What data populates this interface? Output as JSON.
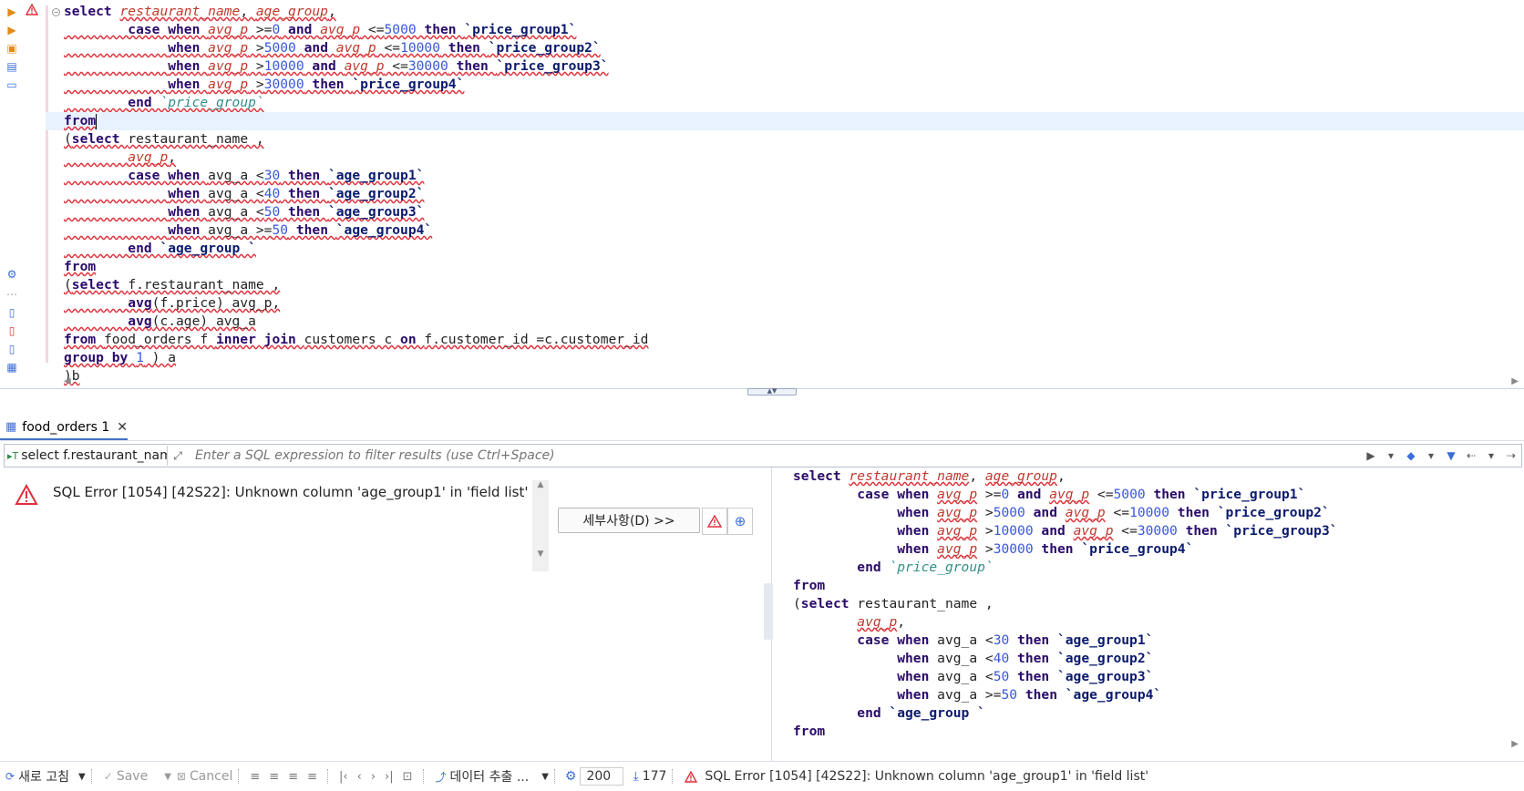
{
  "editor": {
    "lines": [
      [
        [
          "k",
          "select "
        ],
        [
          "id sq",
          "restaurant_name"
        ],
        [
          "pl sq",
          ", "
        ],
        [
          "id sq",
          "age_group"
        ],
        [
          "pl sq",
          ","
        ]
      ],
      [
        [
          "pl sq",
          "        "
        ],
        [
          "k sq",
          "case when "
        ],
        [
          "id sq",
          "avg_p"
        ],
        [
          "pl sq",
          " >="
        ],
        [
          "num sq",
          "0"
        ],
        [
          "k sq",
          " and "
        ],
        [
          "id sq",
          "avg_p"
        ],
        [
          "pl sq",
          " <="
        ],
        [
          "num sq",
          "5000"
        ],
        [
          "k sq",
          " then "
        ],
        [
          "bq sq",
          "`price_group1`"
        ]
      ],
      [
        [
          "pl sq",
          "             "
        ],
        [
          "k sq",
          "when "
        ],
        [
          "id sq",
          "avg_p"
        ],
        [
          "pl sq",
          " >"
        ],
        [
          "num sq",
          "5000"
        ],
        [
          "k sq",
          " and "
        ],
        [
          "id sq",
          "avg_p"
        ],
        [
          "pl sq",
          " <="
        ],
        [
          "num sq",
          "10000"
        ],
        [
          "k sq",
          " then "
        ],
        [
          "bq sq",
          "`price_group2`"
        ]
      ],
      [
        [
          "pl sq",
          "             "
        ],
        [
          "k sq",
          "when "
        ],
        [
          "id sq",
          "avg_p"
        ],
        [
          "pl sq",
          " >"
        ],
        [
          "num sq",
          "10000"
        ],
        [
          "k sq",
          " and "
        ],
        [
          "id sq",
          "avg_p"
        ],
        [
          "pl sq",
          " <="
        ],
        [
          "num sq",
          "30000"
        ],
        [
          "k sq",
          " then "
        ],
        [
          "bq sq",
          "`price_group3`"
        ]
      ],
      [
        [
          "pl sq",
          "             "
        ],
        [
          "k sq",
          "when "
        ],
        [
          "id sq",
          "avg_p"
        ],
        [
          "pl sq",
          " >"
        ],
        [
          "num sq",
          "30000"
        ],
        [
          "k sq",
          " then "
        ],
        [
          "bq sq",
          "`price_group4`"
        ]
      ],
      [
        [
          "pl sq",
          "        "
        ],
        [
          "k sq",
          "end "
        ],
        [
          "bqi sq",
          "`price_group`"
        ]
      ],
      [
        [
          "k sq",
          "from"
        ]
      ],
      [
        [
          "pl sq",
          "("
        ],
        [
          "k sq",
          "select "
        ],
        [
          "pl sq",
          "restaurant_name ,"
        ]
      ],
      [
        [
          "pl sq",
          "        "
        ],
        [
          "id sq",
          "avg_p"
        ],
        [
          "pl sq",
          ","
        ]
      ],
      [
        [
          "pl sq",
          "        "
        ],
        [
          "k sq",
          "case when "
        ],
        [
          "pl sq",
          "avg_a <"
        ],
        [
          "num sq",
          "30"
        ],
        [
          "k sq",
          " then "
        ],
        [
          "bq sq",
          "`age_group1`"
        ]
      ],
      [
        [
          "pl sq",
          "             "
        ],
        [
          "k sq",
          "when "
        ],
        [
          "pl sq",
          "avg_a <"
        ],
        [
          "num sq",
          "40"
        ],
        [
          "k sq",
          " then "
        ],
        [
          "bq sq",
          "`age_group2`"
        ]
      ],
      [
        [
          "pl sq",
          "             "
        ],
        [
          "k sq",
          "when "
        ],
        [
          "pl sq",
          "avg_a <"
        ],
        [
          "num sq",
          "50"
        ],
        [
          "k sq",
          " then "
        ],
        [
          "bq sq",
          "`age_group3`"
        ]
      ],
      [
        [
          "pl sq",
          "             "
        ],
        [
          "k sq",
          "when "
        ],
        [
          "pl sq",
          "avg_a >="
        ],
        [
          "num sq",
          "50"
        ],
        [
          "k sq",
          " then "
        ],
        [
          "bq sq",
          "`age_group4`"
        ]
      ],
      [
        [
          "pl sq",
          "        "
        ],
        [
          "k sq",
          "end "
        ],
        [
          "bq sq",
          "`age_group `"
        ]
      ],
      [
        [
          "k sq",
          "from"
        ]
      ],
      [
        [
          "pl sq",
          "("
        ],
        [
          "k sq",
          "select "
        ],
        [
          "pl sq",
          "f.restaurant_name ,"
        ]
      ],
      [
        [
          "pl sq",
          "        "
        ],
        [
          "k sq",
          "avg"
        ],
        [
          "pl sq",
          "(f.price) avg_p,"
        ]
      ],
      [
        [
          "pl sq",
          "        "
        ],
        [
          "k sq",
          "avg"
        ],
        [
          "pl sq",
          "(c.age) avg_a"
        ]
      ],
      [
        [
          "k sq",
          "from "
        ],
        [
          "pl sq",
          "food_orders f "
        ],
        [
          "k sq",
          "inner join "
        ],
        [
          "pl sq",
          "customers c "
        ],
        [
          "k sq",
          "on "
        ],
        [
          "pl sq",
          "f.customer_id =c.customer_id"
        ]
      ],
      [
        [
          "k sq",
          "group by "
        ],
        [
          "num sq",
          "1"
        ],
        [
          "pl sq",
          " ) a"
        ]
      ],
      [
        [
          "pl sq",
          ")b"
        ]
      ]
    ]
  },
  "results_tab": {
    "label": "food_orders 1"
  },
  "filter": {
    "query_label": "select f.restaurant_name",
    "placeholder": "Enter a SQL expression to filter results (use Ctrl+Space)"
  },
  "error": {
    "message": "SQL Error [1054] [42S22]: Unknown column 'age_group1' in 'field list'",
    "details_button": "세부사항(D) >>"
  },
  "sql_preview": {
    "lines": [
      [
        [
          "k",
          "select "
        ],
        [
          "id sq",
          "restaurant_name"
        ],
        [
          "pl",
          ", "
        ],
        [
          "id sq",
          "age_group"
        ],
        [
          "pl",
          ","
        ]
      ],
      [
        [
          "pl",
          "        "
        ],
        [
          "k",
          "case when "
        ],
        [
          "id sq",
          "avg_p"
        ],
        [
          "pl",
          " >="
        ],
        [
          "num",
          "0"
        ],
        [
          "k",
          " and "
        ],
        [
          "id sq",
          "avg_p"
        ],
        [
          "pl",
          " <="
        ],
        [
          "num",
          "5000"
        ],
        [
          "k",
          " then "
        ],
        [
          "bq",
          "`price_group1`"
        ]
      ],
      [
        [
          "pl",
          "             "
        ],
        [
          "k",
          "when "
        ],
        [
          "id sq",
          "avg_p"
        ],
        [
          "pl",
          " >"
        ],
        [
          "num",
          "5000"
        ],
        [
          "k",
          " and "
        ],
        [
          "id sq",
          "avg_p"
        ],
        [
          "pl",
          " <="
        ],
        [
          "num",
          "10000"
        ],
        [
          "k",
          " then "
        ],
        [
          "bq",
          "`price_group2`"
        ]
      ],
      [
        [
          "pl",
          "             "
        ],
        [
          "k",
          "when "
        ],
        [
          "id sq",
          "avg_p"
        ],
        [
          "pl",
          " >"
        ],
        [
          "num",
          "10000"
        ],
        [
          "k",
          " and "
        ],
        [
          "id sq",
          "avg_p"
        ],
        [
          "pl",
          " <="
        ],
        [
          "num",
          "30000"
        ],
        [
          "k",
          " then "
        ],
        [
          "bq",
          "`price_group3`"
        ]
      ],
      [
        [
          "pl",
          "             "
        ],
        [
          "k",
          "when "
        ],
        [
          "id sq",
          "avg_p"
        ],
        [
          "pl",
          " >"
        ],
        [
          "num",
          "30000"
        ],
        [
          "k",
          " then "
        ],
        [
          "bq",
          "`price_group4`"
        ]
      ],
      [
        [
          "pl",
          "        "
        ],
        [
          "k",
          "end "
        ],
        [
          "bqi",
          "`price_group`"
        ]
      ],
      [
        [
          "k",
          "from"
        ]
      ],
      [
        [
          "pl",
          "("
        ],
        [
          "k",
          "select "
        ],
        [
          "pl",
          "restaurant_name ,"
        ]
      ],
      [
        [
          "pl",
          "        "
        ],
        [
          "id sq",
          "avg_p"
        ],
        [
          "pl",
          ","
        ]
      ],
      [
        [
          "pl",
          "        "
        ],
        [
          "k",
          "case when "
        ],
        [
          "pl",
          "avg_a <"
        ],
        [
          "num",
          "30"
        ],
        [
          "k",
          " then "
        ],
        [
          "bq",
          "`age_group1`"
        ]
      ],
      [
        [
          "pl",
          "             "
        ],
        [
          "k",
          "when "
        ],
        [
          "pl",
          "avg_a <"
        ],
        [
          "num",
          "40"
        ],
        [
          "k",
          " then "
        ],
        [
          "bq",
          "`age_group2`"
        ]
      ],
      [
        [
          "pl",
          "             "
        ],
        [
          "k",
          "when "
        ],
        [
          "pl",
          "avg_a <"
        ],
        [
          "num",
          "50"
        ],
        [
          "k",
          " then "
        ],
        [
          "bq",
          "`age_group3`"
        ]
      ],
      [
        [
          "pl",
          "             "
        ],
        [
          "k",
          "when "
        ],
        [
          "pl",
          "avg_a >="
        ],
        [
          "num",
          "50"
        ],
        [
          "k",
          " then "
        ],
        [
          "bq",
          "`age_group4`"
        ]
      ],
      [
        [
          "pl",
          "        "
        ],
        [
          "k",
          "end "
        ],
        [
          "bq",
          "`age_group `"
        ]
      ],
      [
        [
          "k",
          "from"
        ]
      ]
    ]
  },
  "toolbar": {
    "refresh": "새로 고침",
    "save": "Save",
    "cancel": "Cancel",
    "export": "데이터 추출 ...",
    "row_limit": "200",
    "row_count": "177",
    "status_error": "SQL Error [1054] [42S22]: Unknown column 'age_group1' in 'field list'"
  },
  "colors": {
    "keyword": "#2a0a6b",
    "identifier": "#c0392b",
    "number": "#3858d8",
    "quoted_alias": "#0a1a6e",
    "accent": "#3f72c7",
    "error": "#e0303a"
  }
}
